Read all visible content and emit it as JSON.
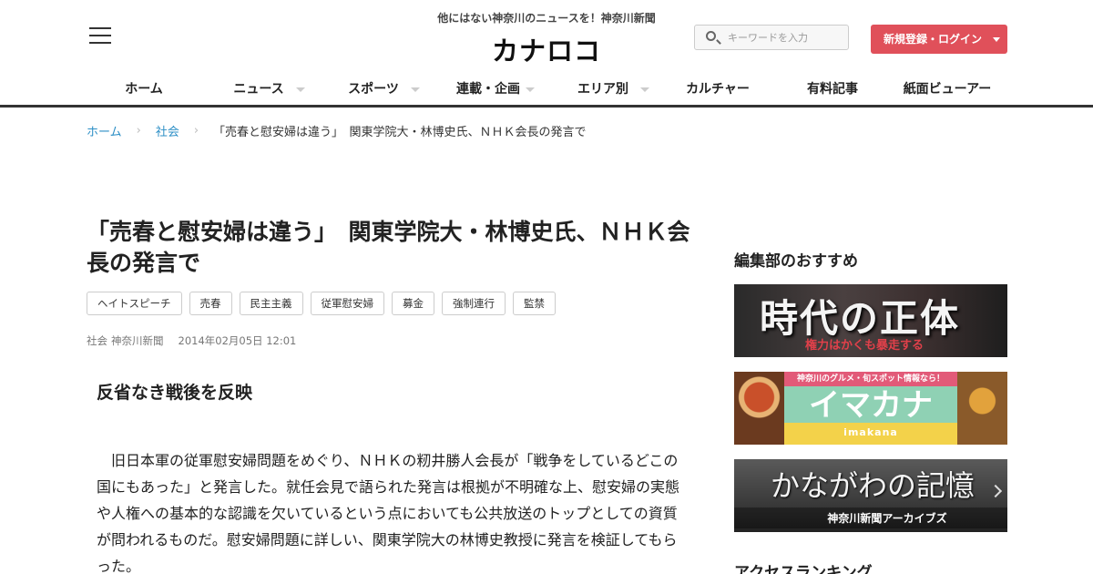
{
  "header": {
    "tagline": "他にはない神奈川のニュースを！神奈川新聞",
    "logo": "カナロコ",
    "search_placeholder": "キーワードを入力",
    "login_label": "新規登録・ログイン"
  },
  "nav": [
    {
      "label": "ホーム",
      "dropdown": false
    },
    {
      "label": "ニュース",
      "dropdown": true
    },
    {
      "label": "スポーツ",
      "dropdown": true
    },
    {
      "label": "連載・企画",
      "dropdown": true
    },
    {
      "label": "エリア別",
      "dropdown": true
    },
    {
      "label": "カルチャー",
      "dropdown": false
    },
    {
      "label": "有料記事",
      "dropdown": false
    },
    {
      "label": "紙面ビューアー",
      "dropdown": false
    }
  ],
  "breadcrumb": {
    "home": "ホーム",
    "category": "社会",
    "current": "「売春と慰安婦は違う」　関東学院大・林博史氏、ＮＨＫ会長の発言で"
  },
  "article": {
    "title": "「売春と慰安婦は違う」　関東学院大・林博史氏、ＮＨＫ会長の発言で",
    "tags": [
      "ヘイトスピーチ",
      "売春",
      "民主主義",
      "従軍慰安婦",
      "募金",
      "強制連行",
      "監禁"
    ],
    "category": "社会",
    "source": "神奈川新聞",
    "date": "2014年02月05日 12:01",
    "subhead": "反省なき戦後を反映",
    "body": "旧日本軍の従軍慰安婦問題をめぐり、ＮＨＫの籾井勝人会長が「戦争をしているどこの国にもあった」と発言した。就任会見で語られた発言は根拠が不明確な上、慰安婦の実態や人権への基本的な認識を欠いているという点においても公共放送のトップとしての資質が問われるものだ。慰安婦問題に詳しい、関東学院大の林博史教授に発言を検証してもらった。"
  },
  "sidebar": {
    "recommend_title": "編集部のおすすめ",
    "banner1": {
      "main": "時代の正体",
      "sub": "権力はかくも暴走する"
    },
    "banner2": {
      "top": "神奈川のグルメ・旬スポット情報なら！",
      "main": "イマカナ",
      "sub": "imakana"
    },
    "banner3": {
      "main": "かながわの記憶",
      "sub": "神奈川新聞アーカイブズ"
    },
    "ranking_title": "アクセスランキング"
  }
}
